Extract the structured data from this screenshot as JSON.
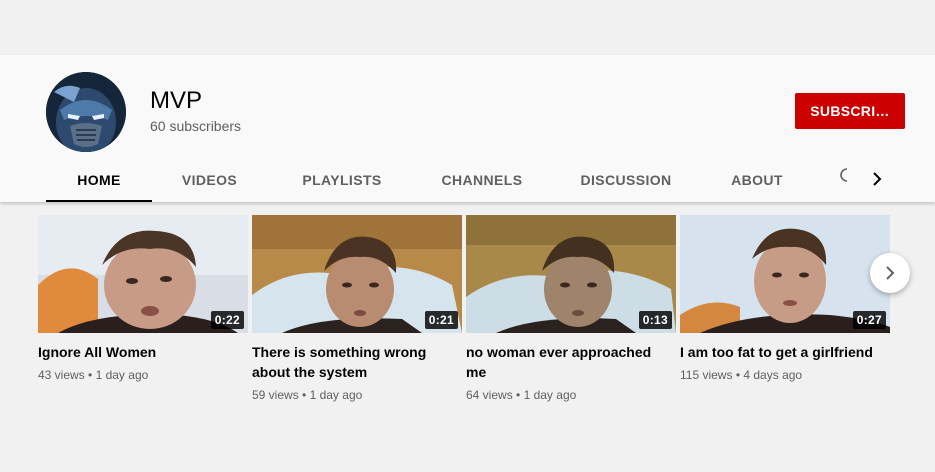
{
  "channel": {
    "name": "MVP",
    "subscribers": "60 subscribers",
    "subscribe_label": "SUBSCRI…"
  },
  "tabs": [
    {
      "label": "HOME",
      "active": true
    },
    {
      "label": "VIDEOS"
    },
    {
      "label": "PLAYLISTS"
    },
    {
      "label": "CHANNELS"
    },
    {
      "label": "DISCUSSION"
    },
    {
      "label": "ABOUT"
    }
  ],
  "tab_icons": {
    "search": "search-icon",
    "next": "chevron-right-icon"
  },
  "videos": [
    {
      "title": "Ignore All Women",
      "duration": "0:22",
      "views": "43 views",
      "age": "1 day ago"
    },
    {
      "title": "There is something wrong about the system",
      "duration": "0:21",
      "views": "59 views",
      "age": "1 day ago"
    },
    {
      "title": "no woman ever approached me",
      "duration": "0:13",
      "views": "64 views",
      "age": "1 day ago"
    },
    {
      "title": "I am too fat to get a girlfriend",
      "duration": "0:27",
      "views": "115 views",
      "age": "4 days ago"
    }
  ],
  "meta_separator": "•",
  "colors": {
    "accent": "#cc0000",
    "background": "#f1f1f1",
    "header": "#f9f9f9"
  }
}
